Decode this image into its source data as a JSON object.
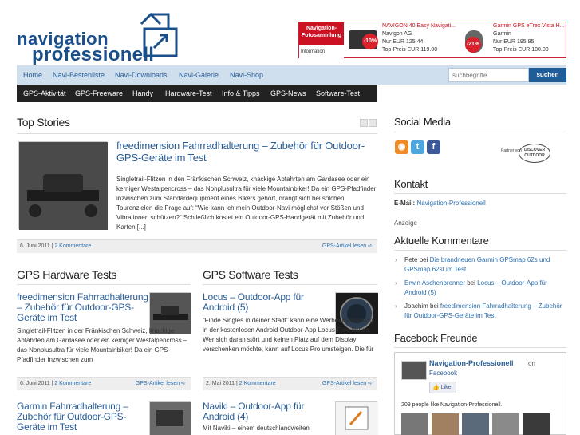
{
  "logo": {
    "line1": "navigation",
    "line2": "professionell"
  },
  "ad": {
    "left_label": "Navigation-Fotosammlung",
    "left_sub": "Information",
    "products": [
      {
        "name": "NAVIGON 40 Easy Navigati...",
        "brand": "Navigon AG",
        "price": "Nur EUR 125.44",
        "top": "Top-Preis EUR 119.00",
        "badge": "-10%"
      },
      {
        "name": "Garmin GPS eTrex Vista H...",
        "brand": "Garmin",
        "price": "Nur EUR 195.95",
        "top": "Top-Preis EUR 180.00",
        "badge": "-21%"
      }
    ]
  },
  "nav1": {
    "items": [
      "Home",
      "Navi-Bestenliste",
      "Navi-Downloads",
      "Navi-Galerie",
      "Navi-Shop"
    ],
    "search_placeholder": "suchbegriffe",
    "search_button": "suchen"
  },
  "nav2": {
    "items": [
      "GPS-Aktivität",
      "GPS-Freeware",
      "Handy",
      "Hardware-Test",
      "Info & Tipps",
      "GPS-News",
      "Software-Test"
    ]
  },
  "top_stories": {
    "title": "Top Stories",
    "article": {
      "title": "freedimension Fahrradhalterung – Zubehör für Outdoor-GPS-Geräte im Test",
      "excerpt": "Singletrail-Flitzen in den Fränkischen Schweiz, knackige Abfahrten am Gardasee oder ein kerniger Westalpencross – das Nonplusultra für viele Mountainbiker! Da ein GPS-Pfadfinder inzwischen zum Standardequipment eines Bikers gehört, drängt sich bei solchen Tourenzielen die Frage auf: “Wie kann ich mein Outdoor-Navi möglichst vor Stößen und Vibrationen schützen?” Schließlich kostet ein Outdoor-GPS-Handgerät mit Zubehör und Karten [...]",
      "date": "6. Juni 2011",
      "sep": " | ",
      "comments": "2 Kommentare",
      "more": "GPS-Artikel lesen"
    }
  },
  "hardware": {
    "title": "GPS Hardware Tests",
    "article1": {
      "title": "freedimension Fahrradhalterung – Zubehör für Outdoor-GPS-Geräte im Test",
      "excerpt": "Singletrail-Flitzen in der Fränkischen Schweiz, knackige Abfahrten am Gardasee oder ein kerniger Westalpencross – das Nonplusultra für viele Mountainbiker! Da ein GPS-Pfadfinder inzwischen zum",
      "date": "6. Juni 2011",
      "sep": " | ",
      "comments": "2 Kommentare",
      "more": "GPS-Artikel lesen"
    },
    "article2": {
      "title": "Garmin Fahrradhalterung – Zubehör für Outdoor-GPS-Geräte im Test"
    }
  },
  "software": {
    "title": "GPS Software Tests",
    "article1": {
      "title": "Locus – Outdoor-App für Android (5)",
      "excerpt": "“Finde Singles in deiner Stadt” kann eine Werbeeinblendung in der kostenlosen Android Outdoor-App Locus Free lauten. Wer sich daran stört und keinen Platz auf dem Display verschenken möchte, kann auf Locus Pro umsteigen. Die für",
      "date": "2. Mai 2011",
      "sep": " | ",
      "comments": "2 Kommentare",
      "more": "GPS-Artikel lesen"
    },
    "article2": {
      "title": "Naviki – Outdoor-App für Android (4)",
      "excerpt": "Mit Naviki – einem deutschlandweiten"
    }
  },
  "sidebar": {
    "social_title": "Social Media",
    "partner_von": "Partner von",
    "partner_name": "DISCOVER OUTDOOR",
    "kontakt_title": "Kontakt",
    "email_label": "E-Mail:",
    "email_value": "Navigation-Professionell",
    "anzeige": "Anzeige",
    "comments_title": "Aktuelle Kommentare",
    "comments": [
      {
        "author": "Pete",
        "mid": " bei ",
        "link": "Die brandneuen Garmin GPSmap 62s und GPSmap 62st im Test"
      },
      {
        "author": "Erwin Aschenbrenner",
        "mid": " bei ",
        "link": "Locus – Outdoor-App für Android (5)"
      },
      {
        "author": "Joachim",
        "mid": " bei ",
        "link": "freedimension Fahrradhalterung – Zubehör für Outdoor-GPS-Geräte im Test"
      }
    ],
    "facebook_title": "Facebook Freunde",
    "fb_name": "Navigation-Professionell",
    "fb_on": "on",
    "fb_sub": "Facebook",
    "fb_like": "Like",
    "fb_people": "209 people like Navigation-Professionell."
  },
  "colors": {
    "brand": "#1a4f8a",
    "nav1_bg": "#cfdfee",
    "nav2_bg": "#222222",
    "link": "#2a6fb0"
  }
}
